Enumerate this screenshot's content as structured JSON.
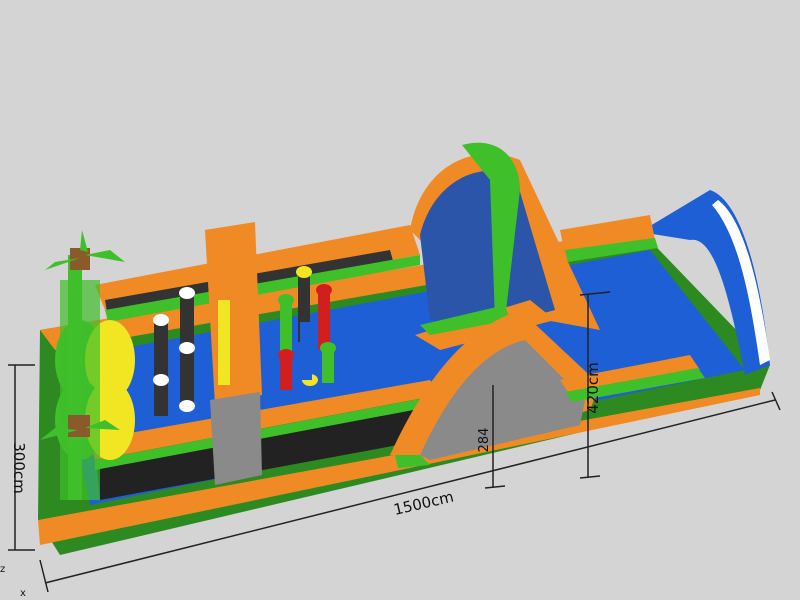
{
  "scene": {
    "subject": "",
    "colors": {
      "background": "#d4d4d4",
      "orange": "#f08a24",
      "green": "#3fbf2a",
      "blue": "#1f5fd6",
      "dark": "#2a2a2a",
      "gray": "#8a8a8a",
      "yellow": "#f2e521",
      "red": "#d11f1f",
      "white": "#ffffff"
    }
  },
  "dimensions": {
    "length": "1500cm",
    "width": "300cm",
    "height": "420cm",
    "platform": "284"
  },
  "axis": {
    "x": "x",
    "z": "z"
  }
}
